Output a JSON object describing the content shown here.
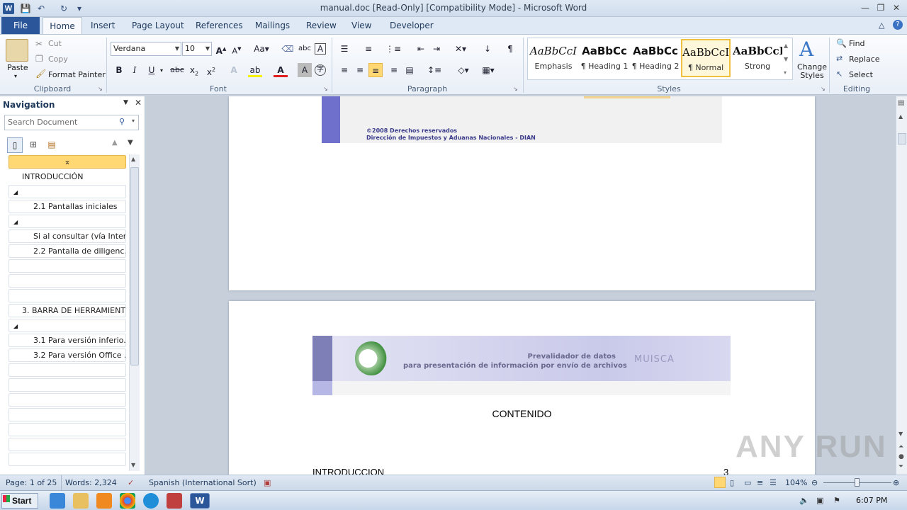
{
  "window": {
    "title": "manual.doc [Read-Only] [Compatibility Mode]  -  Microsoft Word"
  },
  "tabs": [
    "File",
    "Home",
    "Insert",
    "Page Layout",
    "References",
    "Mailings",
    "Review",
    "View",
    "Developer"
  ],
  "clipboard": {
    "paste": "Paste",
    "cut": "Cut",
    "copy": "Copy",
    "format_painter": "Format Painter",
    "label": "Clipboard"
  },
  "font": {
    "name": "Verdana",
    "size": "10",
    "label": "Font"
  },
  "paragraph": {
    "label": "Paragraph"
  },
  "styles": {
    "label": "Styles",
    "items": [
      {
        "sample": "AaBbCcI",
        "name": "Emphasis"
      },
      {
        "sample": "AaBbCc",
        "name": "¶ Heading 1"
      },
      {
        "sample": "AaBbCc",
        "name": "¶ Heading 2"
      },
      {
        "sample": "AaBbCcI",
        "name": "¶ Normal"
      },
      {
        "sample": "AaBbCcI",
        "name": "Strong"
      }
    ],
    "change": "Change Styles"
  },
  "editing": {
    "find": "Find",
    "replace": "Replace",
    "select": "Select",
    "label": "Editing"
  },
  "nav": {
    "title": "Navigation",
    "search_placeholder": "Search Document",
    "items": [
      "INTRODUCCIÓN",
      "",
      "2.1 Pantallas iniciales",
      "",
      "Si al consultar (vía Inter...",
      "2.2 Pantalla de diligenc...",
      "",
      "",
      "",
      "3. BARRA DE HERRAMIENT...",
      "",
      "3.1 Para versión inferio...",
      "3.2 Para versión Office ..."
    ]
  },
  "document": {
    "banner_top_line1": "©2008 Derechos reservados",
    "banner_top_line2": "Dirección de Impuestos y Aduanas Nacionales - DIAN",
    "banner_title1": "Prevalidador de datos",
    "banner_title2": "para presentación de información por envío de archivos",
    "banner_logo": "MUISCA",
    "heading": "CONTENIDO",
    "toc_first": "INTRODUCCION",
    "toc_first_page": "3"
  },
  "status": {
    "page": "Page: 1 of 25",
    "words": "Words: 2,324",
    "language": "Spanish (International Sort)",
    "zoom": "104%"
  },
  "taskbar": {
    "start": "Start",
    "time": "6:07 PM"
  },
  "watermark": "ANY RUN"
}
